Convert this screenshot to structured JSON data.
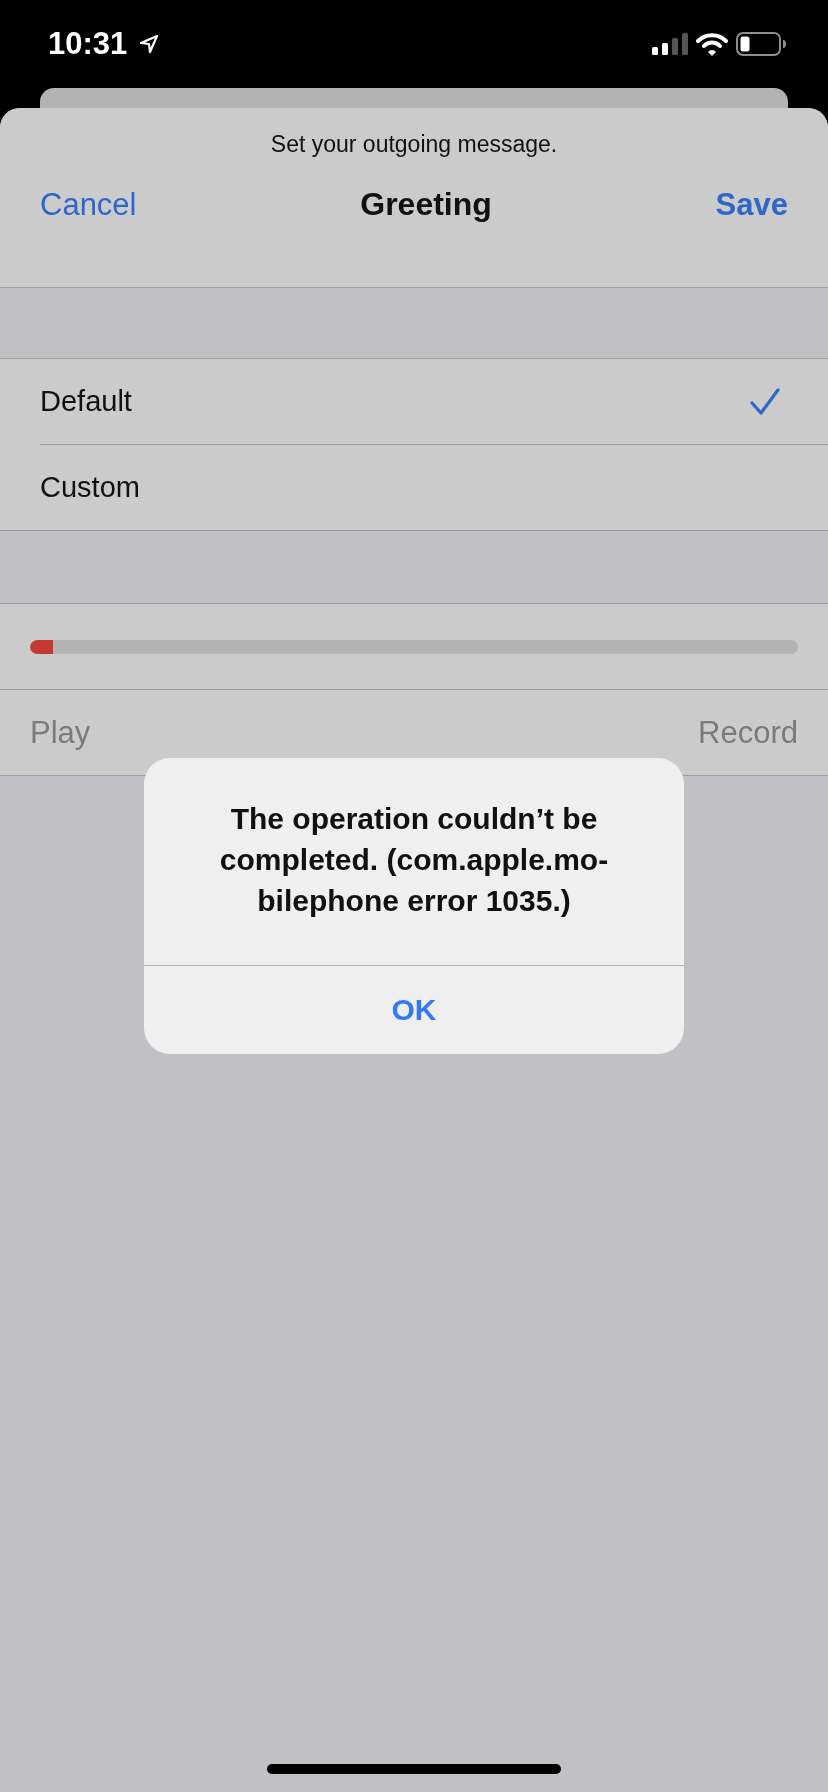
{
  "status_bar": {
    "time": "10:31"
  },
  "sheet": {
    "subtitle": "Set your outgoing message.",
    "title": "Greeting",
    "cancel": "Cancel",
    "save": "Save"
  },
  "options": [
    {
      "label": "Default",
      "selected": true
    },
    {
      "label": "Custom",
      "selected": false
    }
  ],
  "recording": {
    "level": 0.03
  },
  "controls": [
    {
      "label": "Play",
      "disabled": true
    },
    {
      "label": "Record",
      "disabled": true
    }
  ],
  "alert": {
    "message_lines": [
      "The operation couldn’t be",
      "completed. (com.apple.mo-",
      "bilephone error 1035.)"
    ],
    "button": "OK"
  }
}
